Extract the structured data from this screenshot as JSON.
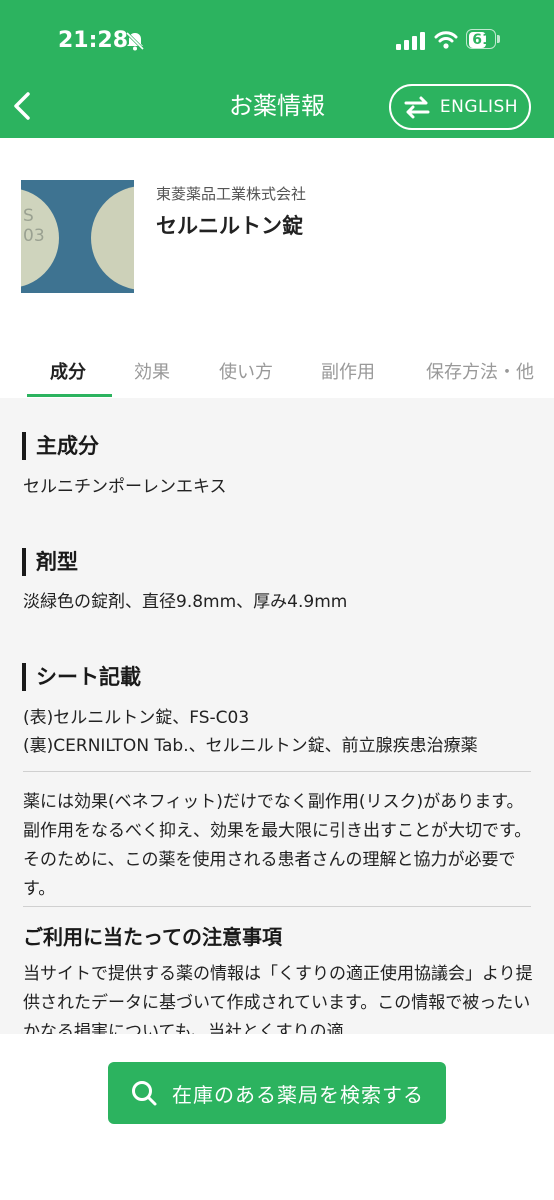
{
  "status_bar": {
    "time": "21:28",
    "battery": "61"
  },
  "nav": {
    "title": "お薬情報",
    "language_button": "ENGLISH"
  },
  "product": {
    "maker": "東菱薬品工業株式会社",
    "name": "セルニルトン錠",
    "imprint_fragment": "S\n03"
  },
  "tabs": [
    "成分",
    "効果",
    "使い方",
    "副作用",
    "保存方法・他"
  ],
  "sections": {
    "main_ingredient": {
      "title": "主成分",
      "text": "セルニチンポーレンエキス"
    },
    "form": {
      "title": "剤型",
      "text": "淡緑色の錠剤、直径9.8mm、厚み4.9mm"
    },
    "sheet": {
      "title": "シート記載",
      "line1": "(表)セルニルトン錠、FS-C03",
      "line2": "(裏)CERNILTON Tab.、セルニルトン錠、前立腺疾患治療薬"
    },
    "notice": "薬には効果(ベネフィット)だけでなく副作用(リスク)があります。副作用をなるべく抑え、効果を最大限に引き出すことが大切です。そのために、この薬を使用される患者さんの理解と協力が必要です。",
    "caution": {
      "title": "ご利用に当たっての注意事項",
      "text": "当サイトで提供する薬の情報は「くすりの適正使用協議会」より提供されたデータに基づいて作成されています。この情報で被ったいかなる損害についても、当社とくすりの適"
    }
  },
  "bottom": {
    "search_button": "在庫のある薬局を検索する"
  },
  "colors": {
    "brand_green": "#2cb35f",
    "content_bg": "#f5f5f5"
  }
}
